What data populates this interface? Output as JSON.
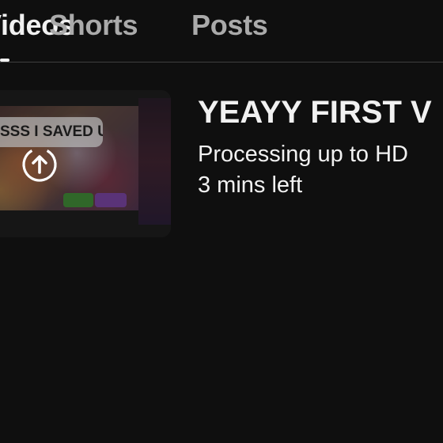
{
  "tabs": {
    "videos_label": "Videos",
    "shorts_label": "Shorts",
    "posts_label": "Posts"
  },
  "upload": {
    "thumbnail_caption": "SSS I SAVED UP",
    "thumbnail_icon": "upload-arrow-icon",
    "title": "YEAYY FIRST V",
    "status": "Processing up to HD",
    "time_left": "3 mins left"
  },
  "colors": {
    "background": "#0f0f0f",
    "active_text": "#f1f1f1",
    "inactive_text": "#aaaaaa",
    "divider": "#3f3f3f"
  }
}
